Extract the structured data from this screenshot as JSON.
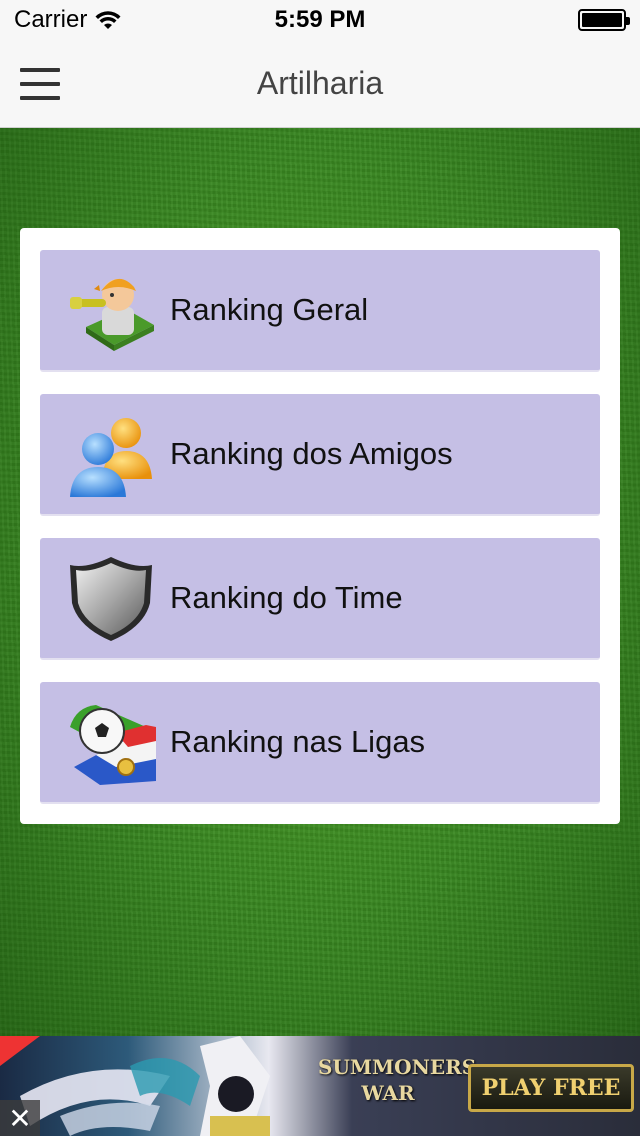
{
  "status_bar": {
    "carrier": "Carrier",
    "time": "5:59 PM"
  },
  "nav": {
    "title": "Artilharia"
  },
  "rankings": [
    {
      "label": "Ranking Geral",
      "icon": "referee-whistle-icon"
    },
    {
      "label": "Ranking dos Amigos",
      "icon": "friends-icon"
    },
    {
      "label": "Ranking do Time",
      "icon": "shield-icon"
    },
    {
      "label": "Ranking nas Ligas",
      "icon": "league-ball-flag-icon"
    }
  ],
  "ad": {
    "brand": "SUMMONERS WAR",
    "cta": "PLAY FREE",
    "close": "✕"
  },
  "colors": {
    "item_bg": "#c5bfe5",
    "nav_bg": "#f7f7f7",
    "field": "#3a8a22"
  }
}
